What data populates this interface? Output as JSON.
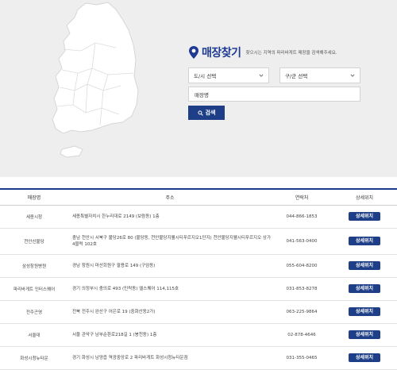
{
  "finder": {
    "title": "매장찾기",
    "description": "찾으시는 지역의 파리바게트 매장을 검색해주세요.",
    "city_select": "도/시 선택",
    "district_select": "구/군 선택",
    "store_placeholder": "매장명",
    "search_label": "검색"
  },
  "table": {
    "headers": [
      "매장명",
      "주소",
      "연락처",
      "상세위치"
    ],
    "rows": [
      {
        "name": "세종시청",
        "address": "세종특별자치시 한누리대로 2149 (보람동) 1층",
        "phone": "044-866-1853",
        "action": "상세위치"
      },
      {
        "name": "천안신불당",
        "address": "충남 천안시 서북구 불당26로 80 (불당동, 천안불당지웰시티푸르지오1단지) 천안불당지웰시티푸르지오 상가 4블럭 102호",
        "phone": "041-563-0400",
        "action": "상세위치"
      },
      {
        "name": "삼성창원병원",
        "address": "경남 창원시 마산회원구 팔용로 149 (구암동)",
        "phone": "055-604-8200",
        "action": "상세위치"
      },
      {
        "name": "파리바게트 인터스퀘어",
        "address": "경기 의정부시 충의로 493 (민락동) 엘스퀘어 114,115호",
        "phone": "031-853-8278",
        "action": "상세위치"
      },
      {
        "name": "전주곤영",
        "address": "전북 전주시 완산구 어은로 19 (중화산동2가)",
        "phone": "063-225-9864",
        "action": "상세위치"
      },
      {
        "name": "서울대",
        "address": "서울 관악구 남부순환로218길 1 (봉천동) 1층",
        "phone": "02-878-4646",
        "action": "상세위치"
      },
      {
        "name": "화성시청뉴타운",
        "address": "경기 화성시 남양읍 역광중앙로 2 파리바게트 화성시청뉴타운점",
        "phone": "031-355-0465",
        "action": "상세위치"
      }
    ]
  },
  "colors": {
    "accent": "#1f3a93",
    "button": "#1e3f87",
    "panel": "#eeeeee"
  }
}
